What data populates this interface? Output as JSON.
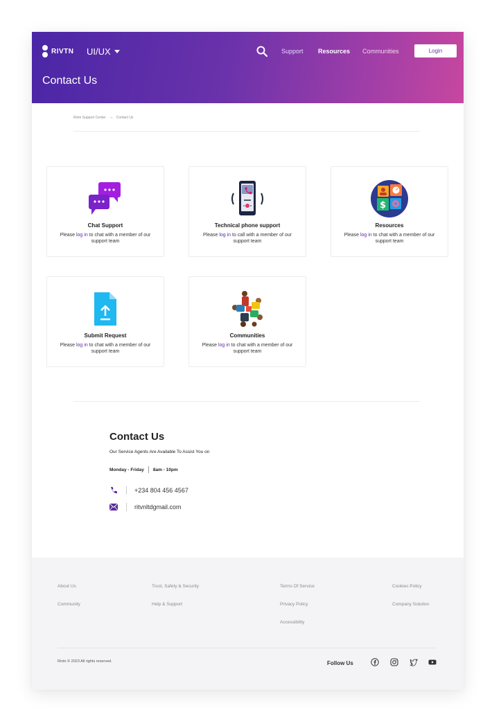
{
  "header": {
    "logo_text": "RIVTN",
    "product_label": "UI/UX",
    "nav": {
      "support": "Support",
      "resources": "Resources",
      "communities": "Communities"
    },
    "login_label": "Login",
    "page_title": "Contact Us"
  },
  "breadcrumb": {
    "home": "Rivtn Support Center",
    "separator": "→",
    "current": "Contact Us"
  },
  "cards": [
    {
      "title": "Chat Support",
      "pre": "Please ",
      "link": "log in",
      "post": " to chat with a member of our support team",
      "icon": "chat-bubbles-icon"
    },
    {
      "title": "Technical phone support",
      "pre": "Please ",
      "link": "log in",
      "post": " to call with a member of our support team",
      "icon": "phone-call-icon"
    },
    {
      "title": "Resources",
      "pre": "Please ",
      "link": "log in",
      "post": " to chat with a member of our support team",
      "icon": "resources-grid-icon"
    },
    {
      "title": "Submit Request",
      "pre": "Please ",
      "link": "log in",
      "post": " to chat with a member of our support team",
      "icon": "file-upload-icon"
    },
    {
      "title": "Communities",
      "pre": "Please ",
      "link": "log in",
      "post": " to chat with a member of our support team",
      "icon": "people-community-icon"
    }
  ],
  "contact": {
    "title": "Contact Us",
    "description": "Our Service  Agents Are Available To Assist You on",
    "days": "Monday - Friday",
    "hours": "8am - 10pm",
    "phone": "+234 804 456 4567",
    "email": "ritvnltdgmail.com"
  },
  "footer": {
    "col1": [
      "About Us",
      "Community"
    ],
    "col2": [
      "Trust, Safety & Security",
      "Help & Support"
    ],
    "col3": [
      "Terms Of Service",
      "Privacy Policy",
      "Accessibility"
    ],
    "col4": [
      "Cookies Policy",
      "Company Solution"
    ],
    "copyright": "Rivtn © 2023 All rights reserved.",
    "follow_label": "Follow  Us"
  },
  "colors": {
    "brand_purple": "#5b2b9b",
    "gradient_start": "#4a26a6",
    "gradient_end": "#c7479f",
    "footer_bg": "#f4f3f6"
  }
}
